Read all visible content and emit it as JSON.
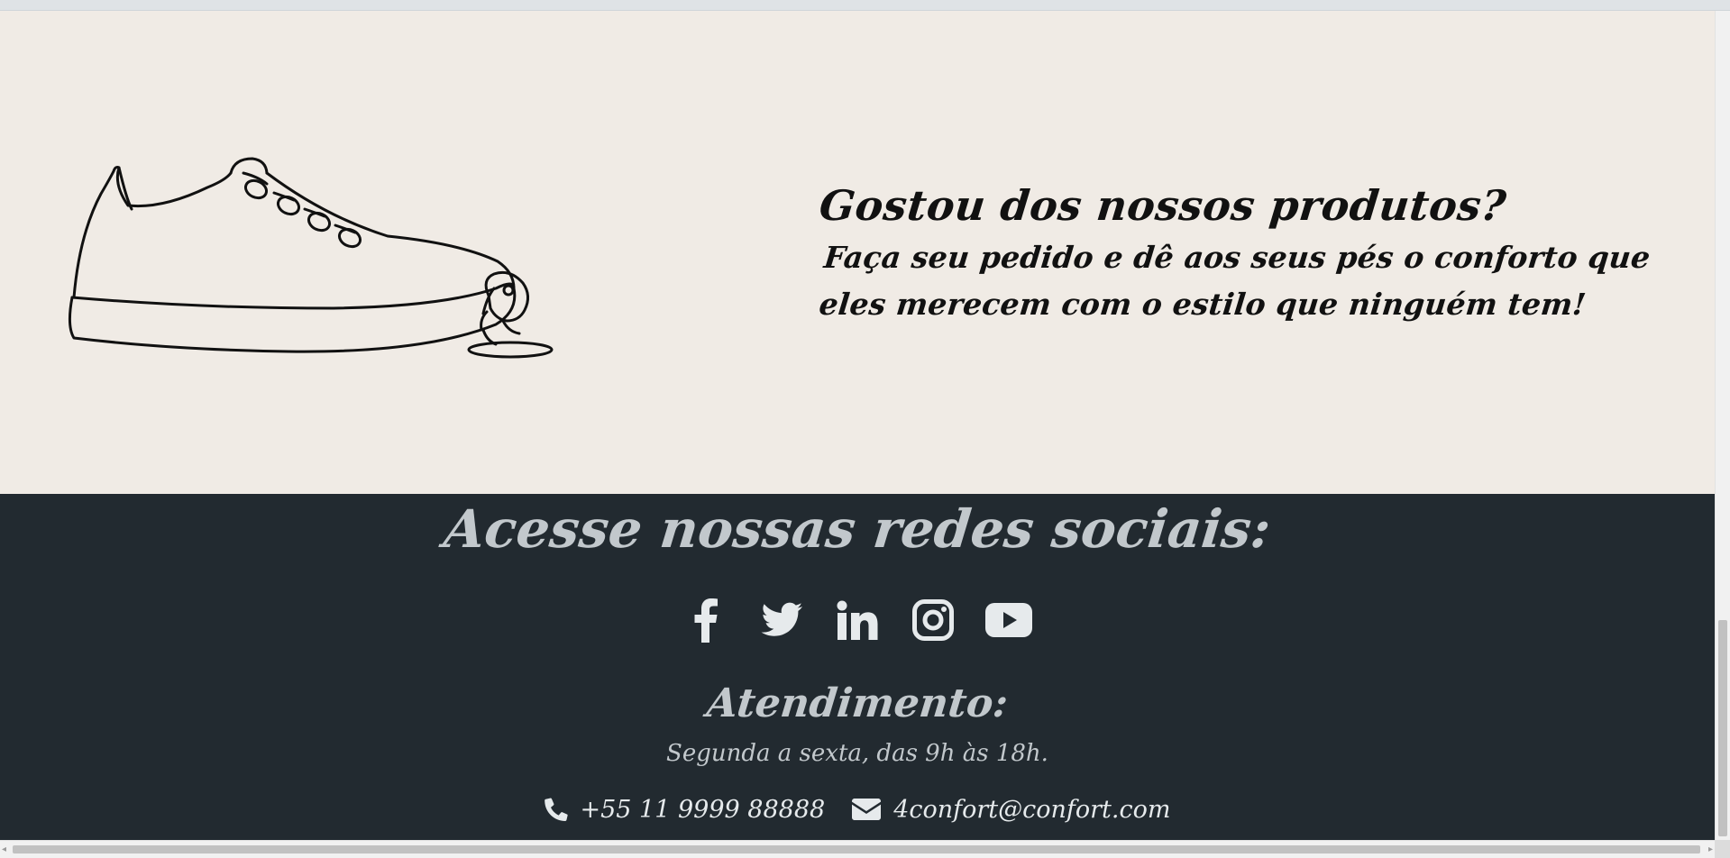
{
  "promo": {
    "title": "Gostou dos nossos produtos?",
    "body": "Faça seu pedido e dê aos seus pés o conforto que eles merecem com o estilo que ninguém tem!",
    "illustration_icon": "sneaker-illustration"
  },
  "footer": {
    "social_heading": "Acesse nossas redes sociais:",
    "social_links": [
      {
        "icon": "facebook-icon"
      },
      {
        "icon": "twitter-icon"
      },
      {
        "icon": "linkedin-icon"
      },
      {
        "icon": "instagram-icon"
      },
      {
        "icon": "youtube-icon"
      }
    ],
    "service_heading": "Atendimento:",
    "service_hours": "Segunda a sexta, das 9h às 18h.",
    "phone": "+55 11 9999 88888",
    "email": "4confort@confort.com"
  },
  "colors": {
    "promo_background": "#f0ebe5",
    "footer_background": "#222a30",
    "footer_text": "#c2c8cc",
    "icon_color": "#e6eaec"
  }
}
